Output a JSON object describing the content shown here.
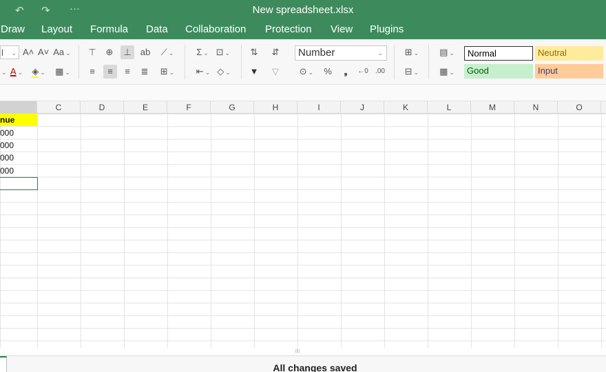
{
  "titlebar": {
    "title": "New spreadsheet.xlsx",
    "undo_icon": "↶",
    "redo_icon": "↷",
    "more_icon": "···"
  },
  "menu": [
    "Draw",
    "Layout",
    "Formula",
    "Data",
    "Collaboration",
    "Protection",
    "View",
    "Plugins"
  ],
  "toolbar": {
    "font_size_partial": "l",
    "increase_font": "A˄",
    "decrease_font": "A˅",
    "change_case": "Aa",
    "font_color": "A",
    "number_format": "Number",
    "percent": "%",
    "comma": "̓",
    "styles": {
      "normal": "Normal",
      "neutral": "Neutral",
      "good": "Good",
      "input": "Input"
    },
    "style_colors": {
      "normal": "#ffffff",
      "neutral": "#ffeb9c",
      "good": "#c6efce",
      "input": "#ffcc99"
    }
  },
  "columns": [
    "C",
    "D",
    "E",
    "F",
    "G",
    "H",
    "I",
    "J",
    "K",
    "L",
    "M",
    "N",
    "O"
  ],
  "cells": {
    "header": "nue",
    "rows": [
      "000",
      "000",
      "000",
      "000"
    ]
  },
  "status": {
    "text": "All changes saved"
  },
  "colors": {
    "brand": "#3d8b5c",
    "header_fill": "#ffff00"
  }
}
